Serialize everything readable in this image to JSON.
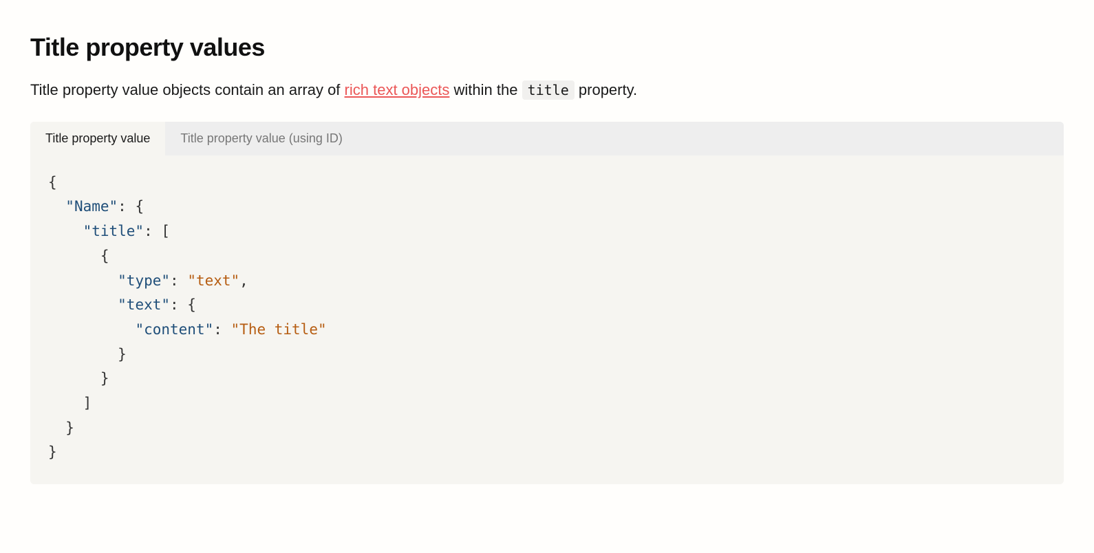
{
  "heading": "Title property values",
  "intro": {
    "before_link": "Title property value objects contain an array of ",
    "link_text": "rich text objects",
    "after_link_before_code": " within the ",
    "code_text": "title",
    "after_code": " property."
  },
  "tabs": [
    {
      "label": "Title property value",
      "active": true
    },
    {
      "label": "Title property value (using ID)",
      "active": false
    }
  ],
  "code": {
    "l1": "{",
    "l2_indent": "  ",
    "l2_key": "\"Name\"",
    "l2_after": ": {",
    "l3_indent": "    ",
    "l3_key": "\"title\"",
    "l3_after": ": [",
    "l4_indent": "      ",
    "l4_text": "{",
    "l5_indent": "        ",
    "l5_key": "\"type\"",
    "l5_mid": ": ",
    "l5_val": "\"text\"",
    "l5_end": ",",
    "l6_indent": "        ",
    "l6_key": "\"text\"",
    "l6_after": ": {",
    "l7_indent": "          ",
    "l7_key": "\"content\"",
    "l7_mid": ": ",
    "l7_val": "\"The title\"",
    "l8_indent": "        ",
    "l8_text": "}",
    "l9_indent": "      ",
    "l9_text": "}",
    "l10_indent": "    ",
    "l10_text": "]",
    "l11_indent": "  ",
    "l11_text": "}",
    "l12": "}"
  }
}
